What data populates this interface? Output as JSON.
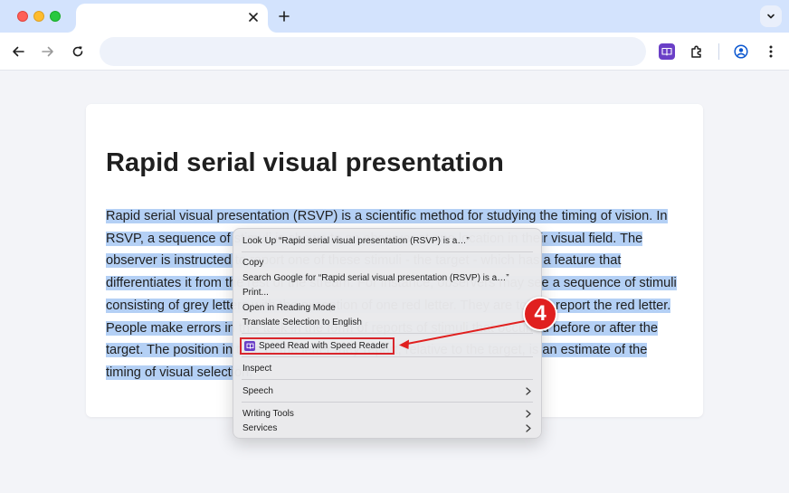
{
  "browser": {
    "tab_title": "",
    "new_tab_symbol": "+",
    "address": "",
    "colors": {
      "titlebar": "#d3e3fd",
      "toolbar": "#ffffff",
      "accent_extension": "#6a3fc7"
    },
    "icons": [
      "close-icon",
      "plus-icon",
      "chevron-down-icon",
      "back-icon",
      "forward-icon",
      "reload-icon",
      "speed-reader-extension-icon",
      "extensions-puzzle-icon",
      "profile-icon",
      "more-vert-icon"
    ]
  },
  "article": {
    "heading": "Rapid serial visual presentation",
    "paragraph": "Rapid serial visual presentation (RSVP) is a scientific method for studying the timing of vision. In RSVP, a sequence of stimuli is shown to an observer at one location in their visual field. The observer is instructed to report one of these stimuli - the target - which has a feature that differentiates it from the rest of the stream. For instance, observers may see a sequence of stimuli consisting of grey letters with the exception of one red letter. They are told to report the red letter. People make errors in this task in the form of reports of stimuli that occurred before or after the target. The position in time of the letter they report, relative to the target, is an estimate of the timing of visual selection.",
    "selection_color": "#b4d0f5"
  },
  "context_menu": {
    "look_up": "Look Up “Rapid serial visual presentation (RSVP) is a…”",
    "copy": "Copy",
    "search_google": "Search Google for “Rapid serial visual presentation (RSVP) is a…”",
    "print": "Print...",
    "open_reading_mode": "Open in Reading Mode",
    "translate": "Translate Selection to English",
    "speed_read": "Speed Read with Speed Reader",
    "inspect": "Inspect",
    "speech": "Speech",
    "writing_tools": "Writing Tools",
    "services": "Services",
    "highlight_color": "#d9262c"
  },
  "annotation": {
    "step_number": "4",
    "color": "#e0201f"
  }
}
